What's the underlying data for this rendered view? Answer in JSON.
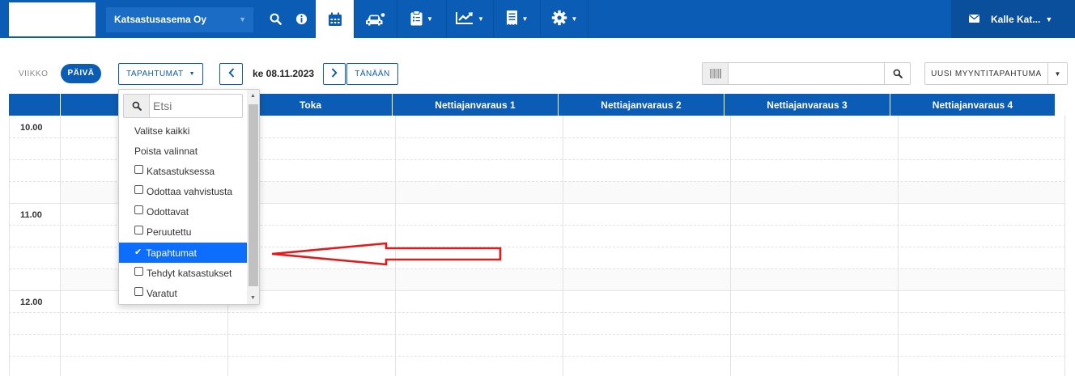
{
  "topbar": {
    "company": "Katsastusasema Oy",
    "user_name": "Kalle Kat...",
    "icons": [
      "search-icon",
      "info-icon",
      "calendar-icon",
      "car-icon",
      "clipboard-icon",
      "chart-icon",
      "receipt-icon",
      "gear-icon",
      "mail-icon"
    ]
  },
  "toolbar": {
    "view_week": "VIIKKO",
    "view_day": "PÄIVÄ",
    "filter_label": "TAPAHTUMAT",
    "date": "ke 08.11.2023",
    "today": "TÄNÄÄN",
    "search_value": "",
    "new_sale": "UUSI MYYNTITAPAHTUMA"
  },
  "calendar": {
    "columns": [
      "",
      "Toka",
      "Nettiajanvaraus 1",
      "Nettiajanvaraus 2",
      "Nettiajanvaraus 3",
      "Nettiajanvaraus 4"
    ],
    "hours": [
      "10.00",
      "11.00",
      "12.00"
    ]
  },
  "dropdown": {
    "search_placeholder": "Etsi",
    "select_all": "Valitse kaikki",
    "clear_all": "Poista valinnat",
    "options": [
      {
        "label": "Katsastuksessa",
        "checked": false
      },
      {
        "label": "Odottaa vahvistusta",
        "checked": false
      },
      {
        "label": "Odottavat",
        "checked": false
      },
      {
        "label": "Peruutettu",
        "checked": false
      },
      {
        "label": "Tapahtumat",
        "checked": true
      },
      {
        "label": "Tehdyt katsastukset",
        "checked": false
      },
      {
        "label": "Varatut",
        "checked": false
      }
    ]
  },
  "colors": {
    "brand": "#0b5cb4",
    "selected": "#0d6efd",
    "annotation": "#e01b1b"
  }
}
